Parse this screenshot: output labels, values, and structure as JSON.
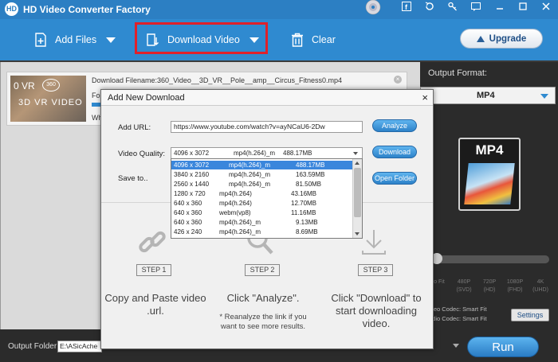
{
  "app": {
    "title": "HD Video Converter Factory",
    "logo_text": "HD"
  },
  "toolbar": {
    "add_files": "Add Files",
    "download_video": "Download Video",
    "clear": "Clear",
    "upgrade": "Upgrade"
  },
  "task": {
    "filename": "Download Filename:360_Video__3D_VR__Pole__amp__Circus_Fitness0.mp4",
    "format_prefix": "For",
    "wh_prefix": "Wh",
    "thumb_line1": "0 VR",
    "thumb_badge": "360",
    "thumb_line2": "3D VR VIDEO",
    "close": "×"
  },
  "output": {
    "label": "Output Format:",
    "format": "MP4",
    "card_text": "MP4",
    "resolutions": [
      "to Fit",
      "480P (SVD)",
      "720P (HD)",
      "1080P (FHD)",
      "4K (UHD)"
    ],
    "video_codec": "ideo Codec: Smart Fit",
    "audio_codec": "udio Codec: Smart Fit",
    "settings": "Settings"
  },
  "bottom": {
    "output_folder_label": "Output Folder:",
    "output_folder_value": "E:\\ASicAche",
    "run": "Run"
  },
  "dialog": {
    "title": "Add New Download",
    "close": "×",
    "add_url_label": "Add URL:",
    "url_value": "https://www.youtube.com/watch?v=ayNCaU6-2Dw",
    "analyze": "Analyze",
    "video_quality_label": "Video Quality:",
    "download": "Download",
    "save_to_label": "Save to..",
    "open_folder": "Open Folder",
    "selected": {
      "res": "4096 x 3072",
      "fmt": "mp4(h.264)_m",
      "size": "488.17MB"
    },
    "qualities": [
      {
        "res": "4096 x 3072",
        "fmt": "mp4(h.264)_m",
        "size": "488.17MB"
      },
      {
        "res": "3840 x 2160",
        "fmt": "mp4(h.264)_m",
        "size": "163.59MB"
      },
      {
        "res": "2560 x 1440",
        "fmt": "mp4(h.264)_m",
        "size": "81.50MB"
      },
      {
        "res": "1280 x 720",
        "fmt": "mp4(h.264)",
        "size": "43.16MB"
      },
      {
        "res": "640 x 360",
        "fmt": "mp4(h.264)",
        "size": "12.70MB"
      },
      {
        "res": "640 x 360",
        "fmt": "webm(vp8)",
        "size": "11.16MB"
      },
      {
        "res": "640 x 360",
        "fmt": "mp4(h.264)_m",
        "size": "9.13MB"
      },
      {
        "res": "426 x 240",
        "fmt": "mp4(h.264)_m",
        "size": "8.69MB"
      }
    ],
    "steps": [
      {
        "badge": "STEP 1",
        "text": "Copy and Paste video .url.",
        "note": ""
      },
      {
        "badge": "STEP 2",
        "text": "Click \"Analyze\".",
        "note": "* Reanalyze the link if you want to see more results."
      },
      {
        "badge": "STEP 3",
        "text": "Click \"Download\" to start downloading video.",
        "note": ""
      }
    ]
  }
}
